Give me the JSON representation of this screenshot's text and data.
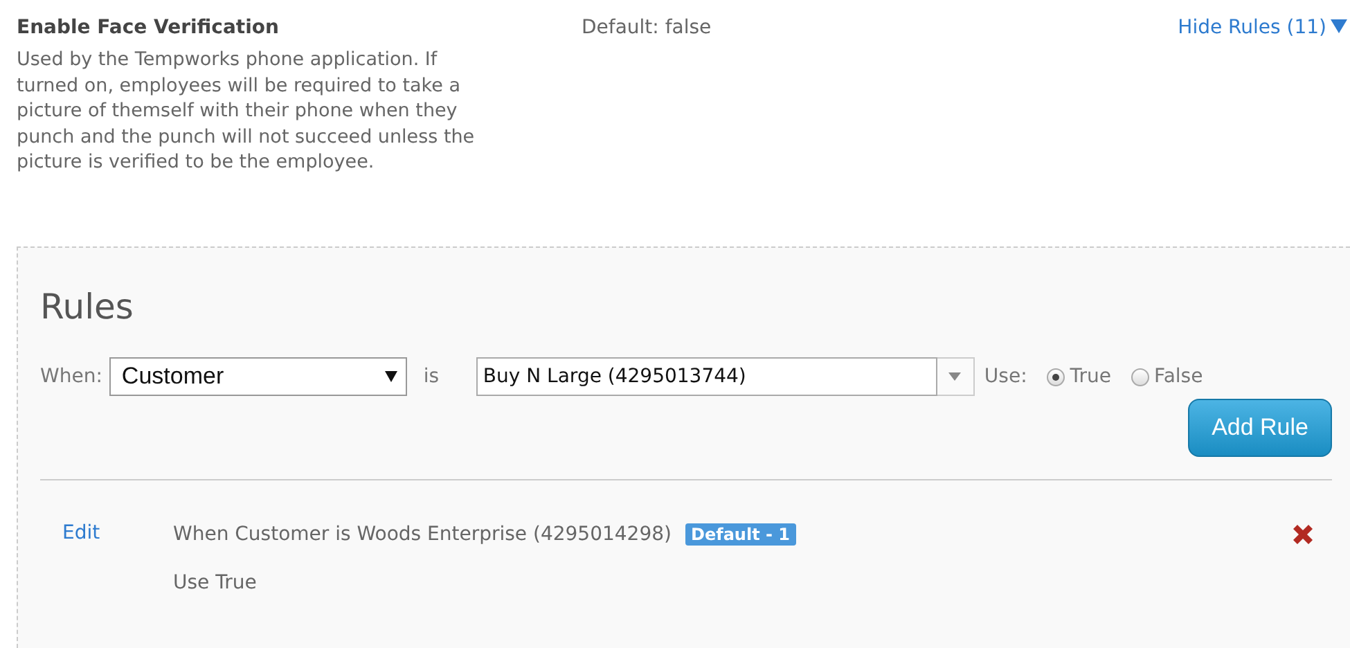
{
  "setting": {
    "title": "Enable Face Verification",
    "description": "Used by the Tempworks phone application. If turned on, employees will be required to take a picture of themself with their phone when they punch and the punch will not succeed unless the picture is verified to be the employee.",
    "default_text": "Default: false",
    "toggle_link": "Hide Rules (11)",
    "expanded": true
  },
  "rules_panel": {
    "heading": "Rules",
    "form": {
      "when_label": "When:",
      "field_select": {
        "value": "Customer"
      },
      "is_label": "is",
      "value_field": {
        "value": "Buy N Large (4295013744)"
      },
      "use_label": "Use:",
      "options": [
        {
          "label": "True",
          "selected": true
        },
        {
          "label": "False",
          "selected": false
        }
      ],
      "add_button": "Add Rule"
    },
    "rules": [
      {
        "edit_link": "Edit",
        "condition": "When Customer is Woods Enterprise (4295014298)",
        "badge": "Default - 1",
        "use_text": "Use True"
      }
    ]
  }
}
